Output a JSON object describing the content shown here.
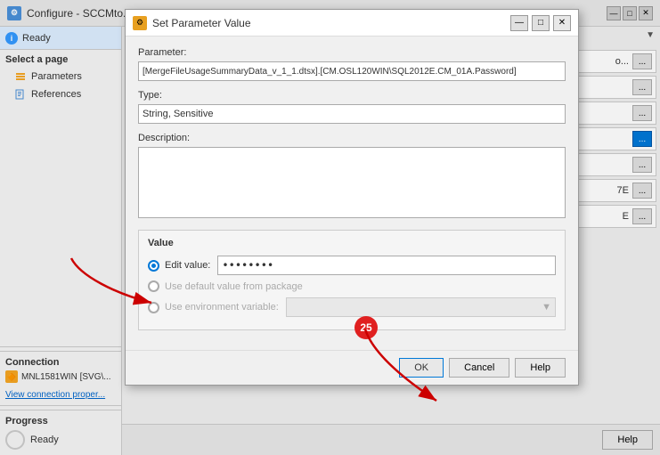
{
  "main": {
    "title": "Configure - SCCMto...",
    "status": "Ready"
  },
  "sidebar": {
    "status_label": "Ready",
    "section_header": "Select a page",
    "items": [
      {
        "label": "Parameters",
        "icon": "parameters"
      },
      {
        "label": "References",
        "icon": "references"
      }
    ],
    "connection_label": "Connection",
    "connection_value": "MNL1581WIN [SVG\\...",
    "view_link": "View connection proper...",
    "progress_label": "Progress",
    "progress_status": "Ready"
  },
  "dialog": {
    "title": "Set Parameter Value",
    "fields": {
      "parameter_label": "Parameter:",
      "parameter_value": "[MergeFileUsageSummaryData_v_1_1.dtsx].[CM.OSL120WIN\\SQL2012E.CM_01A.Password]",
      "type_label": "Type:",
      "type_value": "String, Sensitive",
      "description_label": "Description:",
      "description_value": ""
    },
    "value_section": {
      "label": "Value",
      "options": [
        {
          "label": "Edit value:",
          "selected": true,
          "has_input": true,
          "input_value": "••••••••"
        },
        {
          "label": "Use default value from package",
          "selected": false
        },
        {
          "label": "Use environment variable:",
          "selected": false,
          "has_dropdown": true
        }
      ]
    },
    "buttons": {
      "ok": "OK",
      "cancel": "Cancel",
      "help": "Help"
    }
  },
  "right_panel": {
    "rows": [
      {
        "text": "o...",
        "has_ellipsis": true,
        "selected": false
      },
      {
        "text": "",
        "has_ellipsis": true,
        "selected": false
      },
      {
        "text": "",
        "has_ellipsis": true,
        "selected": false
      },
      {
        "text": "",
        "has_ellipsis": true,
        "selected": true
      },
      {
        "text": "",
        "has_ellipsis": true,
        "selected": false
      },
      {
        "text": "7E",
        "has_ellipsis": true,
        "selected": false
      },
      {
        "text": "E",
        "has_ellipsis": true,
        "selected": false
      }
    ],
    "help_button": "Help",
    "badge_number": "25"
  }
}
